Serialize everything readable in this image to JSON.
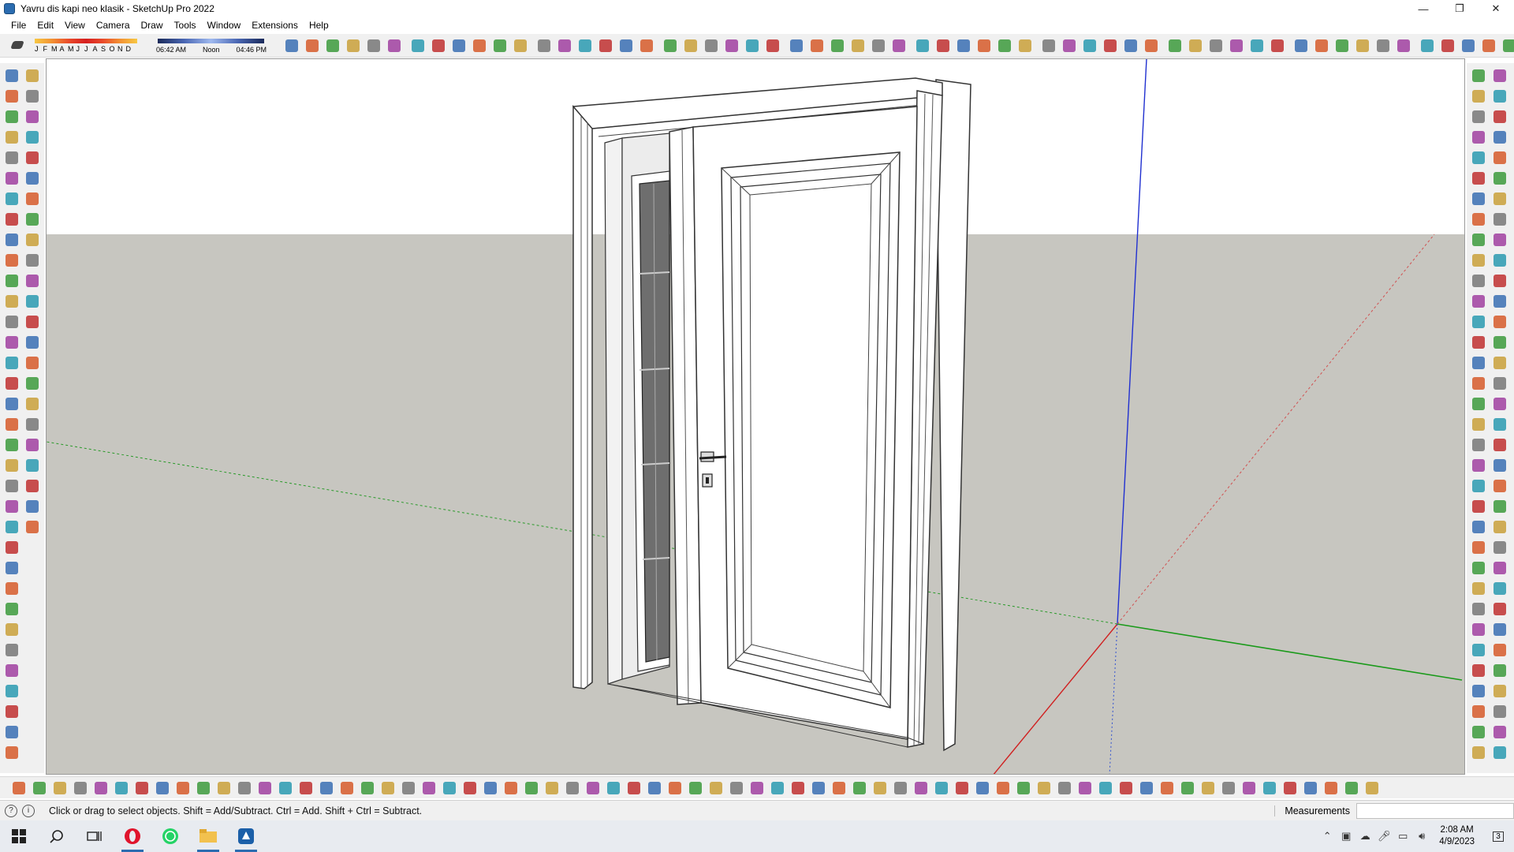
{
  "window": {
    "title": "Yavru dis kapi neo klasik - SketchUp Pro 2022",
    "minimize_symbol": "—",
    "maximize_symbol": "❐",
    "close_symbol": "✕"
  },
  "menu": {
    "items": [
      "File",
      "Edit",
      "View",
      "Camera",
      "Draw",
      "Tools",
      "Window",
      "Extensions",
      "Help"
    ]
  },
  "shadow_settings": {
    "months": [
      "J",
      "F",
      "M",
      "A",
      "M",
      "J",
      "J",
      "A",
      "S",
      "O",
      "N",
      "D"
    ],
    "time_start": "06:42 AM",
    "time_mid": "Noon",
    "time_end": "04:46 PM"
  },
  "status": {
    "hint": "Click or drag to select objects. Shift = Add/Subtract. Ctrl = Add. Shift + Ctrl = Subtract.",
    "measurements_label": "Measurements",
    "measurements_value": ""
  },
  "taskbar": {
    "apps": [
      "start-icon",
      "search-icon",
      "task-view-icon",
      "opera-icon",
      "whatsapp-icon",
      "file-explorer-icon",
      "sketchup-icon"
    ],
    "time": "2:08 AM",
    "date": "4/9/2023",
    "notification_count": "3"
  },
  "colors": {
    "viewport_sky": "#ffffff",
    "viewport_ground": "#c7c6c0",
    "axis_red": "#d02020",
    "axis_green": "#1a9a1a",
    "axis_blue": "#2030d0",
    "accent": "#2b6cb0"
  }
}
